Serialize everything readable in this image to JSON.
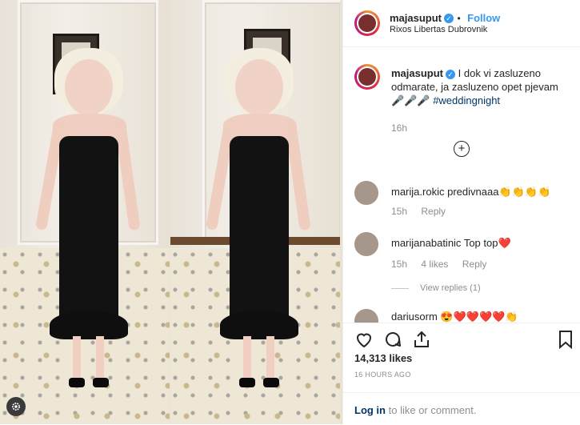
{
  "header": {
    "username": "majasuput",
    "follow_label": "Follow",
    "location": "Rixos Libertas Dubrovnik",
    "separator": "•"
  },
  "caption": {
    "username": "majasuput",
    "text": "I dok vi zasluzeno odmarate, ja zasluzeno opet pjevam 🎤🎤🎤",
    "hashtag": "#weddingnight",
    "time": "16h"
  },
  "comments": [
    {
      "username": "marija.rokic",
      "text": "predivnaaa👏👏👏👏",
      "time": "15h",
      "likes": "",
      "reply_label": "Reply"
    },
    {
      "username": "marijanabatinic",
      "text": "Top top❤️",
      "time": "15h",
      "likes": "4 likes",
      "reply_label": "Reply"
    },
    {
      "username": "dariusorm",
      "text": "😍❤️❤️❤️❤️👏",
      "time": "",
      "likes": "",
      "reply_label": ""
    }
  ],
  "view_replies": "View replies (1)",
  "likes": "14,313 likes",
  "posted": "16 HOURS AGO",
  "footer": {
    "login_label": "Log in",
    "rest": "to like or comment."
  },
  "icons": {
    "like": "heart-icon",
    "comment": "comment-icon",
    "share": "share-icon",
    "save": "bookmark-icon",
    "add_comment": "plus-circle-icon",
    "photo_settings": "gear-icon"
  },
  "colors": {
    "link_blue": "#3897f0",
    "hashtag": "#003569",
    "meta_gray": "#8e8e8e"
  }
}
